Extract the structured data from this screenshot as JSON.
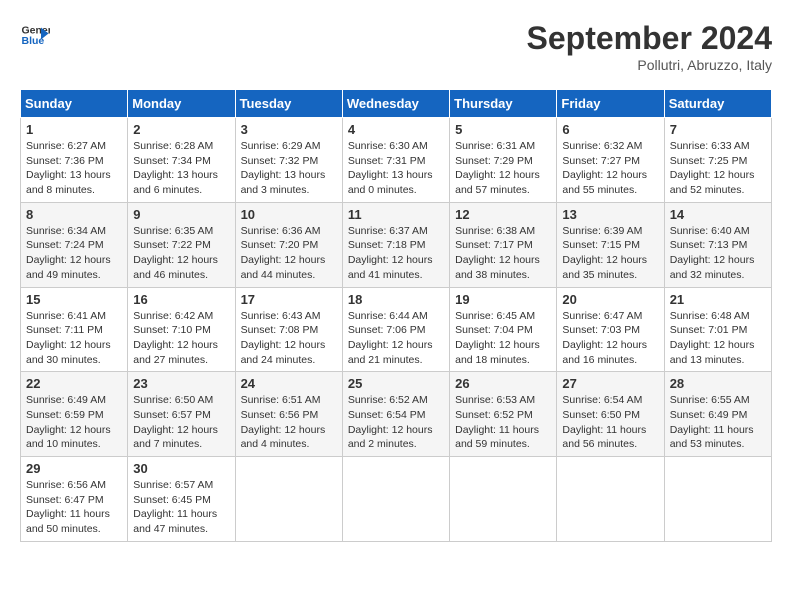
{
  "header": {
    "logo_line1": "General",
    "logo_line2": "Blue",
    "month_title": "September 2024",
    "subtitle": "Pollutri, Abruzzo, Italy"
  },
  "weekdays": [
    "Sunday",
    "Monday",
    "Tuesday",
    "Wednesday",
    "Thursday",
    "Friday",
    "Saturday"
  ],
  "weeks": [
    [
      {
        "day": "1",
        "sunrise": "6:27 AM",
        "sunset": "7:36 PM",
        "daylight": "13 hours and 8 minutes."
      },
      {
        "day": "2",
        "sunrise": "6:28 AM",
        "sunset": "7:34 PM",
        "daylight": "13 hours and 6 minutes."
      },
      {
        "day": "3",
        "sunrise": "6:29 AM",
        "sunset": "7:32 PM",
        "daylight": "13 hours and 3 minutes."
      },
      {
        "day": "4",
        "sunrise": "6:30 AM",
        "sunset": "7:31 PM",
        "daylight": "13 hours and 0 minutes."
      },
      {
        "day": "5",
        "sunrise": "6:31 AM",
        "sunset": "7:29 PM",
        "daylight": "12 hours and 57 minutes."
      },
      {
        "day": "6",
        "sunrise": "6:32 AM",
        "sunset": "7:27 PM",
        "daylight": "12 hours and 55 minutes."
      },
      {
        "day": "7",
        "sunrise": "6:33 AM",
        "sunset": "7:25 PM",
        "daylight": "12 hours and 52 minutes."
      }
    ],
    [
      {
        "day": "8",
        "sunrise": "6:34 AM",
        "sunset": "7:24 PM",
        "daylight": "12 hours and 49 minutes."
      },
      {
        "day": "9",
        "sunrise": "6:35 AM",
        "sunset": "7:22 PM",
        "daylight": "12 hours and 46 minutes."
      },
      {
        "day": "10",
        "sunrise": "6:36 AM",
        "sunset": "7:20 PM",
        "daylight": "12 hours and 44 minutes."
      },
      {
        "day": "11",
        "sunrise": "6:37 AM",
        "sunset": "7:18 PM",
        "daylight": "12 hours and 41 minutes."
      },
      {
        "day": "12",
        "sunrise": "6:38 AM",
        "sunset": "7:17 PM",
        "daylight": "12 hours and 38 minutes."
      },
      {
        "day": "13",
        "sunrise": "6:39 AM",
        "sunset": "7:15 PM",
        "daylight": "12 hours and 35 minutes."
      },
      {
        "day": "14",
        "sunrise": "6:40 AM",
        "sunset": "7:13 PM",
        "daylight": "12 hours and 32 minutes."
      }
    ],
    [
      {
        "day": "15",
        "sunrise": "6:41 AM",
        "sunset": "7:11 PM",
        "daylight": "12 hours and 30 minutes."
      },
      {
        "day": "16",
        "sunrise": "6:42 AM",
        "sunset": "7:10 PM",
        "daylight": "12 hours and 27 minutes."
      },
      {
        "day": "17",
        "sunrise": "6:43 AM",
        "sunset": "7:08 PM",
        "daylight": "12 hours and 24 minutes."
      },
      {
        "day": "18",
        "sunrise": "6:44 AM",
        "sunset": "7:06 PM",
        "daylight": "12 hours and 21 minutes."
      },
      {
        "day": "19",
        "sunrise": "6:45 AM",
        "sunset": "7:04 PM",
        "daylight": "12 hours and 18 minutes."
      },
      {
        "day": "20",
        "sunrise": "6:47 AM",
        "sunset": "7:03 PM",
        "daylight": "12 hours and 16 minutes."
      },
      {
        "day": "21",
        "sunrise": "6:48 AM",
        "sunset": "7:01 PM",
        "daylight": "12 hours and 13 minutes."
      }
    ],
    [
      {
        "day": "22",
        "sunrise": "6:49 AM",
        "sunset": "6:59 PM",
        "daylight": "12 hours and 10 minutes."
      },
      {
        "day": "23",
        "sunrise": "6:50 AM",
        "sunset": "6:57 PM",
        "daylight": "12 hours and 7 minutes."
      },
      {
        "day": "24",
        "sunrise": "6:51 AM",
        "sunset": "6:56 PM",
        "daylight": "12 hours and 4 minutes."
      },
      {
        "day": "25",
        "sunrise": "6:52 AM",
        "sunset": "6:54 PM",
        "daylight": "12 hours and 2 minutes."
      },
      {
        "day": "26",
        "sunrise": "6:53 AM",
        "sunset": "6:52 PM",
        "daylight": "11 hours and 59 minutes."
      },
      {
        "day": "27",
        "sunrise": "6:54 AM",
        "sunset": "6:50 PM",
        "daylight": "11 hours and 56 minutes."
      },
      {
        "day": "28",
        "sunrise": "6:55 AM",
        "sunset": "6:49 PM",
        "daylight": "11 hours and 53 minutes."
      }
    ],
    [
      {
        "day": "29",
        "sunrise": "6:56 AM",
        "sunset": "6:47 PM",
        "daylight": "11 hours and 50 minutes."
      },
      {
        "day": "30",
        "sunrise": "6:57 AM",
        "sunset": "6:45 PM",
        "daylight": "11 hours and 47 minutes."
      },
      null,
      null,
      null,
      null,
      null
    ]
  ]
}
